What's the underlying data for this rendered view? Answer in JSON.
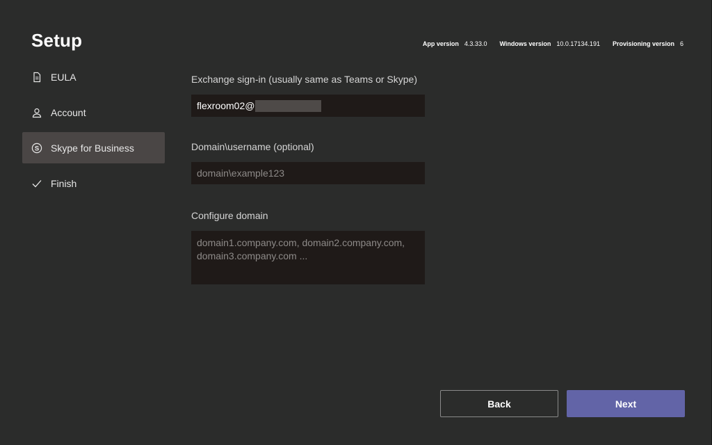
{
  "header": {
    "title": "Setup",
    "versions": [
      {
        "label": "App version",
        "value": "4.3.33.0"
      },
      {
        "label": "Windows version",
        "value": "10.0.17134.191"
      },
      {
        "label": "Provisioning version",
        "value": "6"
      }
    ]
  },
  "nav": {
    "items": [
      {
        "label": "EULA",
        "icon": "document-icon"
      },
      {
        "label": "Account",
        "icon": "person-icon"
      },
      {
        "label": "Skype for Business",
        "icon": "skype-icon",
        "active": true
      },
      {
        "label": "Finish",
        "icon": "checkmark-icon"
      }
    ]
  },
  "form": {
    "exchange": {
      "label": "Exchange sign-in (usually same as Teams or Skype)",
      "value": "flexroom02@"
    },
    "domain_username": {
      "label": "Domain\\username (optional)",
      "placeholder": "domain\\example123"
    },
    "configure_domain": {
      "label": "Configure domain",
      "placeholder": "domain1.company.com, domain2.company.com, domain3.company.com ..."
    }
  },
  "buttons": {
    "back": "Back",
    "next": "Next"
  },
  "colors": {
    "background": "#2b2c2b",
    "accent": "#6264a7",
    "active_nav": "#4a4645",
    "input_bg": "#1f1a18"
  }
}
